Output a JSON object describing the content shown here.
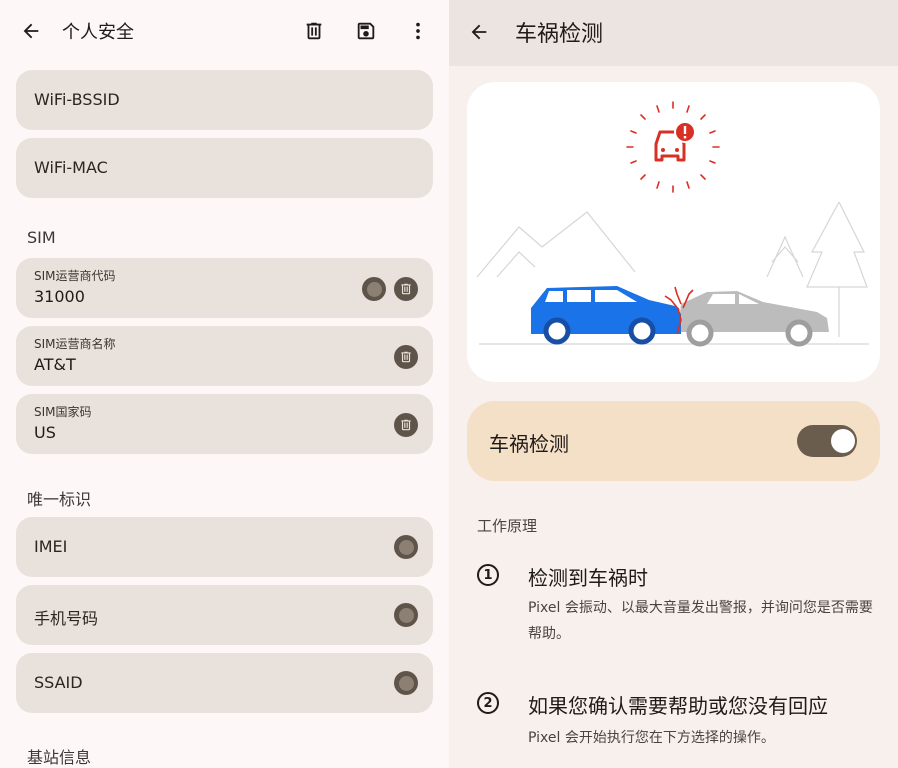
{
  "left": {
    "title": "个人安全",
    "icons": {
      "back": "arrow-left-icon",
      "delete": "trash-icon",
      "save": "save-icon",
      "more": "more-vert-icon"
    },
    "top_cards": [
      {
        "label": "WiFi-BSSID"
      },
      {
        "label": "WiFi-MAC"
      }
    ],
    "sim_header": "SIM",
    "sim_cards": [
      {
        "caption": "SIM运营商代码",
        "value": "31000"
      },
      {
        "caption": "SIM运营商名称",
        "value": "AT&T"
      },
      {
        "caption": "SIM国家码",
        "value": "US"
      }
    ],
    "unique_header": "唯一标识",
    "unique_cards": [
      {
        "label": "IMEI"
      },
      {
        "label": "手机号码"
      },
      {
        "label": "SSAID"
      }
    ],
    "base_header": "基站信息"
  },
  "right": {
    "title": "车祸检测",
    "toggle_label": "车祸检测",
    "toggle_on": true,
    "how_it_works": "工作原理",
    "steps": [
      {
        "num": "1",
        "title": "检测到车祸时",
        "desc": "Pixel 会振动、以最大音量发出警报，并询问您是否需要帮助。"
      },
      {
        "num": "2",
        "title": "如果您确认需要帮助或您没有回应",
        "desc": "Pixel 会开始执行您在下方选择的操作。"
      }
    ]
  },
  "colors": {
    "card_bg": "#e9e1dc",
    "icon_dark": "#5e5449",
    "toggle_card": "#f4dfc7",
    "car_blue": "#1a73e8",
    "alert_red": "#d93025"
  }
}
